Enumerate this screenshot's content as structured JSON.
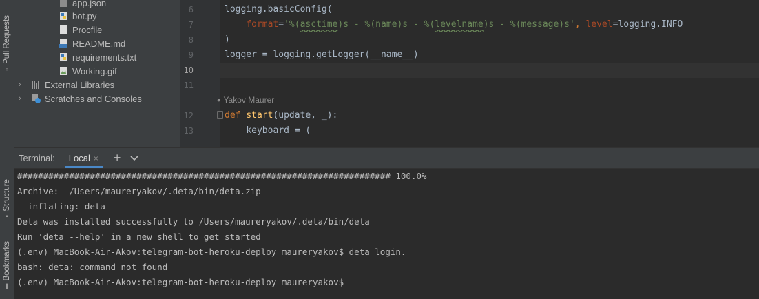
{
  "sidebar": {
    "tabs": [
      {
        "label": "Pull Requests"
      },
      {
        "label": "Structure"
      },
      {
        "label": "Bookmarks"
      }
    ]
  },
  "project": {
    "files": [
      {
        "name": "app.json",
        "icon": "json-file-icon"
      },
      {
        "name": "bot.py",
        "icon": "python-file-icon"
      },
      {
        "name": "Procfile",
        "icon": "text-file-icon"
      },
      {
        "name": "README.md",
        "icon": "markdown-file-icon"
      },
      {
        "name": "requirements.txt",
        "icon": "requirements-file-icon"
      },
      {
        "name": "Working.gif",
        "icon": "image-file-icon"
      }
    ],
    "nodes": [
      {
        "name": "External Libraries",
        "icon": "library-icon"
      },
      {
        "name": "Scratches and Consoles",
        "icon": "scratches-icon"
      }
    ]
  },
  "editor": {
    "line_numbers": [
      "6",
      "7",
      "8",
      "9",
      "10",
      "11",
      "12",
      "13"
    ],
    "author": "Yakov Maurer",
    "lines": {
      "l6": "logging.basicConfig(",
      "l7_param1": "format",
      "l7_eq1": "=",
      "l7_q1": "'%(",
      "l7_asctime": "asctime",
      "l7_mid1": ")s - %(name)s - %(",
      "l7_levelname": "levelname",
      "l7_mid2": ")s - %(message)s'",
      "l7_comma": ", ",
      "l7_param2": "level",
      "l7_tail": "=logging.INFO",
      "l8": ")",
      "l9": "logger = logging.getLogger(__name__)",
      "l12_kw": "def",
      "l12_fn": "start",
      "l12_args": "(update, _):",
      "l13": "keyboard = ("
    }
  },
  "terminal": {
    "title": "Terminal:",
    "tab_label": "Local",
    "close_glyph": "×",
    "add_glyph": "+",
    "lines": [
      "######################################################################## 100.0%",
      "Archive:  /Users/maureryakov/.deta/bin/deta.zip",
      "  inflating: deta",
      "Deta was installed successfully to /Users/maureryakov/.deta/bin/deta",
      "Run 'deta --help' in a new shell to get started",
      "(.env) MacBook-Air-Akov:telegram-bot-heroku-deploy maureryakov$ deta login.",
      "bash: deta: command not found",
      "(.env) MacBook-Air-Akov:telegram-bot-heroku-deploy maureryakov$"
    ]
  },
  "colors": {
    "keyword": "#cc7832",
    "function": "#ffc66d",
    "string": "#6a8759",
    "parameter": "#aa4926",
    "tab_accent": "#4a88c7"
  }
}
